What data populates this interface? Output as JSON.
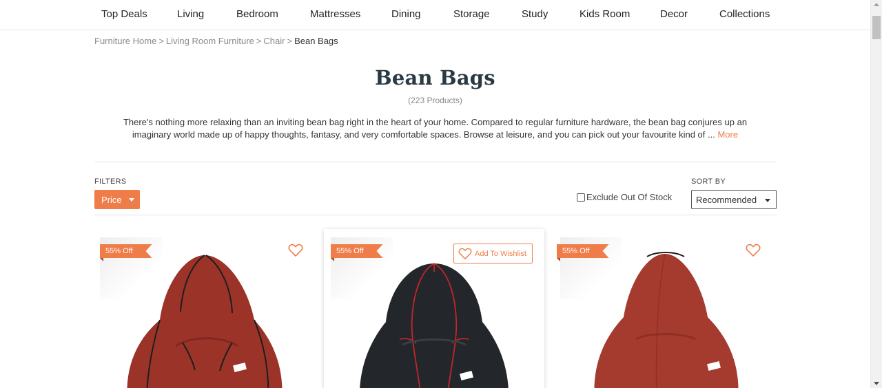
{
  "nav": {
    "items": [
      "Top Deals",
      "Living",
      "Bedroom",
      "Mattresses",
      "Dining",
      "Storage",
      "Study",
      "Kids Room",
      "Decor",
      "Collections"
    ]
  },
  "breadcrumb": {
    "items": [
      "Furniture Home",
      "Living Room Furniture",
      "Chair"
    ],
    "current": "Bean Bags",
    "separator": ">"
  },
  "page": {
    "title": "Bean Bags",
    "count": "(223 Products)",
    "description": "There's nothing more relaxing than an inviting bean bag right in the heart of your home. Compared to regular furniture hardware, the bean bag conjures up an imaginary world made up of happy thoughts, fantasy, and very comfortable spaces. Browse at leisure, and you can pick out your favourite kind of ...",
    "more_label": "More"
  },
  "toolbar": {
    "filters_label": "FILTERS",
    "price_label": "Price",
    "exclude_label": "Exclude Out Of Stock",
    "sort_label": "SORT BY",
    "sort_value": "Recommended"
  },
  "products": [
    {
      "badge": "55% Off",
      "color": "#9b3329",
      "piping": "#1e1e1e",
      "wishlist_label": ""
    },
    {
      "badge": "55% Off",
      "color": "#23262b",
      "piping": "#c2262b",
      "wishlist_label": "Add To Wishlist"
    },
    {
      "badge": "55% Off",
      "color": "#a53a2f",
      "piping": "#8a2d24",
      "wishlist_label": ""
    }
  ],
  "colors": {
    "accent": "#ef7d4a",
    "title": "#2a3a44"
  }
}
